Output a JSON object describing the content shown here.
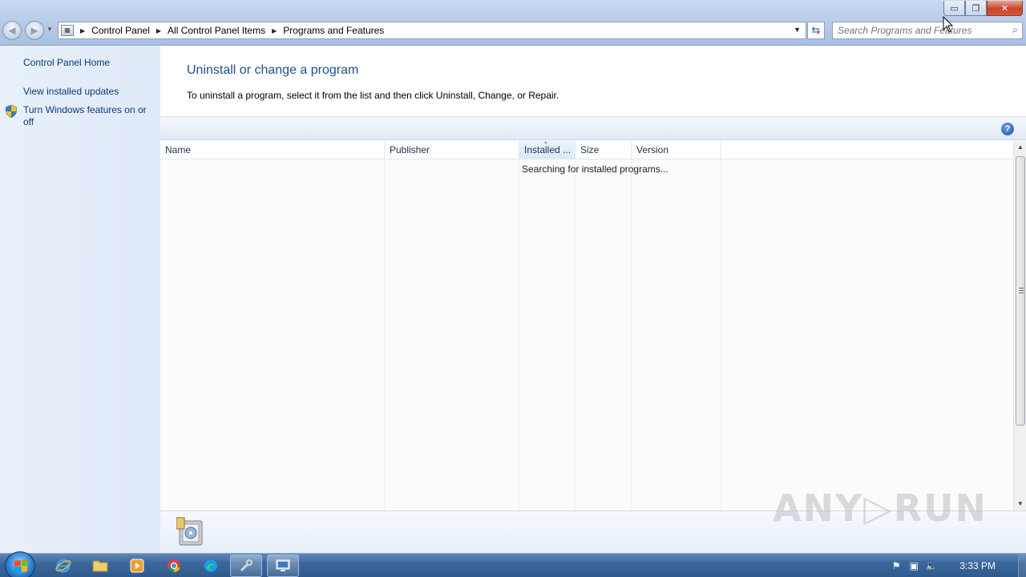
{
  "window": {
    "caption_minimize": "▭",
    "caption_restore": "❐",
    "caption_close": "✕"
  },
  "address_bar": {
    "crumbs": [
      "Control Panel",
      "All Control Panel Items",
      "Programs and Features"
    ]
  },
  "search": {
    "placeholder": "Search Programs and Features"
  },
  "left_pane": {
    "links": [
      "Control Panel Home",
      "View installed updates",
      "Turn Windows features on or off"
    ]
  },
  "main": {
    "heading": "Uninstall or change a program",
    "instructions": "To uninstall a program, select it from the list and then click Uninstall, Change, or Repair.",
    "help_label": "?"
  },
  "list": {
    "columns": [
      "Name",
      "Publisher",
      "Installed ...",
      "Size",
      "Version"
    ],
    "sorted_column": "Installed ...",
    "status": "Searching for installed programs..."
  },
  "watermark": "ANY▷RUN",
  "taskbar": {
    "apps": [
      "internet-explorer-icon",
      "file-explorer-icon",
      "media-player-icon",
      "chrome-icon",
      "edge-icon",
      "control-panel-tools-icon",
      "programs-features-window-icon"
    ],
    "clock": "3:33 PM"
  },
  "colors": {
    "heading": "#1e4f8a",
    "link": "#0b3a7a",
    "taskbar": "#3d679b",
    "close_button": "#c9452a"
  }
}
